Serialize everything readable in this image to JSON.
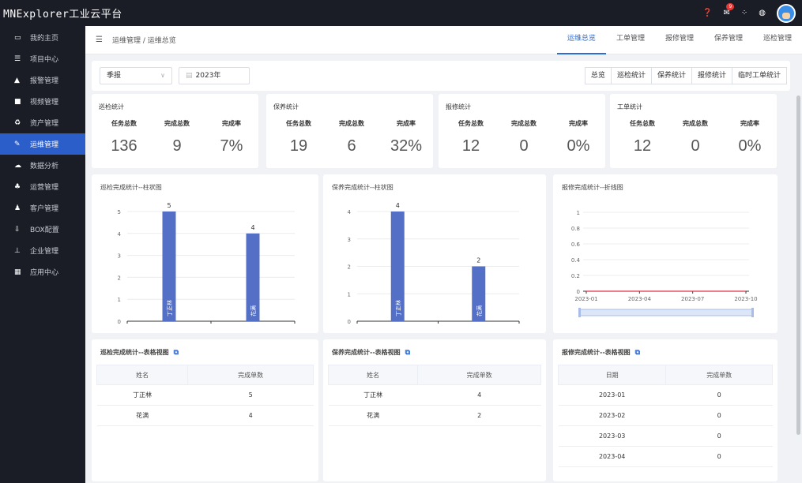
{
  "app": {
    "title": "MNExplorer工业云平台",
    "notification_count": "9"
  },
  "sidebar": {
    "items": [
      {
        "label": "我的主页",
        "icon": "monitor-icon",
        "glyph": "▭"
      },
      {
        "label": "项目中心",
        "icon": "list-icon",
        "glyph": "☰"
      },
      {
        "label": "报警管理",
        "icon": "bell-icon",
        "glyph": "▲"
      },
      {
        "label": "视频管理",
        "icon": "video-icon",
        "glyph": "■"
      },
      {
        "label": "资产管理",
        "icon": "refresh-icon",
        "glyph": "♻"
      },
      {
        "label": "运维管理",
        "icon": "wrench-icon",
        "glyph": "✎",
        "active": true
      },
      {
        "label": "数据分析",
        "icon": "cloud-icon",
        "glyph": "☁"
      },
      {
        "label": "运营管理",
        "icon": "group-icon",
        "glyph": "♣"
      },
      {
        "label": "客户管理",
        "icon": "users-icon",
        "glyph": "♟"
      },
      {
        "label": "BOX配置",
        "icon": "download-icon",
        "glyph": "⇩"
      },
      {
        "label": "企业管理",
        "icon": "sitemap-icon",
        "glyph": "⊥"
      },
      {
        "label": "应用中心",
        "icon": "grid-icon",
        "glyph": "▦"
      }
    ]
  },
  "header": {
    "breadcrumb": "运维管理 / 运维总览",
    "tabs": [
      {
        "label": "运维总览",
        "active": true
      },
      {
        "label": "工单管理"
      },
      {
        "label": "报修管理"
      },
      {
        "label": "保养管理"
      },
      {
        "label": "巡检管理"
      }
    ]
  },
  "filter": {
    "period": "季报",
    "year": "2023年",
    "buttons": [
      "总览",
      "巡检统计",
      "保养统计",
      "报修统计",
      "临时工单统计"
    ]
  },
  "stats": [
    {
      "title": "巡检统计",
      "labels": [
        "任务总数",
        "完成总数",
        "完成率"
      ],
      "values": [
        "136",
        "9",
        "7%"
      ]
    },
    {
      "title": "保养统计",
      "labels": [
        "任务总数",
        "完成总数",
        "完成率"
      ],
      "values": [
        "19",
        "6",
        "32%"
      ]
    },
    {
      "title": "报修统计",
      "labels": [
        "任务总数",
        "完成总数",
        "完成率"
      ],
      "values": [
        "12",
        "0",
        "0%"
      ]
    },
    {
      "title": "工单统计",
      "labels": [
        "任务总数",
        "完成总数",
        "完成率"
      ],
      "values": [
        "12",
        "0",
        "0%"
      ]
    }
  ],
  "chart_data": [
    {
      "type": "bar",
      "title": "巡检完成统计--柱状图",
      "categories": [
        "丁正林",
        "花满"
      ],
      "values": [
        5,
        4
      ],
      "ylim": [
        0,
        5
      ],
      "yticks": [
        0,
        1,
        2,
        3,
        4,
        5
      ],
      "color": "#5470c6"
    },
    {
      "type": "bar",
      "title": "保养完成统计--柱状图",
      "categories": [
        "丁正林",
        "花满"
      ],
      "values": [
        4,
        2
      ],
      "ylim": [
        0,
        4
      ],
      "yticks": [
        0,
        1,
        2,
        3,
        4
      ],
      "color": "#5470c6"
    },
    {
      "type": "line",
      "title": "报修完成统计--折线图",
      "x": [
        "2023-01",
        "2023-04",
        "2023-07",
        "2023-10"
      ],
      "values": [
        0,
        0,
        0,
        0
      ],
      "ylim": [
        0,
        1
      ],
      "yticks": [
        "0",
        "0.2",
        "0.4",
        "0.6",
        "0.8",
        "1"
      ],
      "color": "#e0304a"
    }
  ],
  "tables": [
    {
      "title": "巡检完成统计--表格视图",
      "columns": [
        "姓名",
        "完成单数"
      ],
      "rows": [
        [
          "丁正林",
          "5"
        ],
        [
          "花满",
          "4"
        ]
      ]
    },
    {
      "title": "保养完成统计--表格视图",
      "columns": [
        "姓名",
        "完成单数"
      ],
      "rows": [
        [
          "丁正林",
          "4"
        ],
        [
          "花满",
          "2"
        ]
      ]
    },
    {
      "title": "报修完成统计--表格视图",
      "columns": [
        "日期",
        "完成单数"
      ],
      "rows": [
        [
          "2023-01",
          "0"
        ],
        [
          "2023-02",
          "0"
        ],
        [
          "2023-03",
          "0"
        ],
        [
          "2023-04",
          "0"
        ]
      ]
    }
  ],
  "colors": {
    "accent": "#2c6bd8",
    "sidebar_bg": "#1a1d26",
    "active_item": "#2c5ec9"
  }
}
